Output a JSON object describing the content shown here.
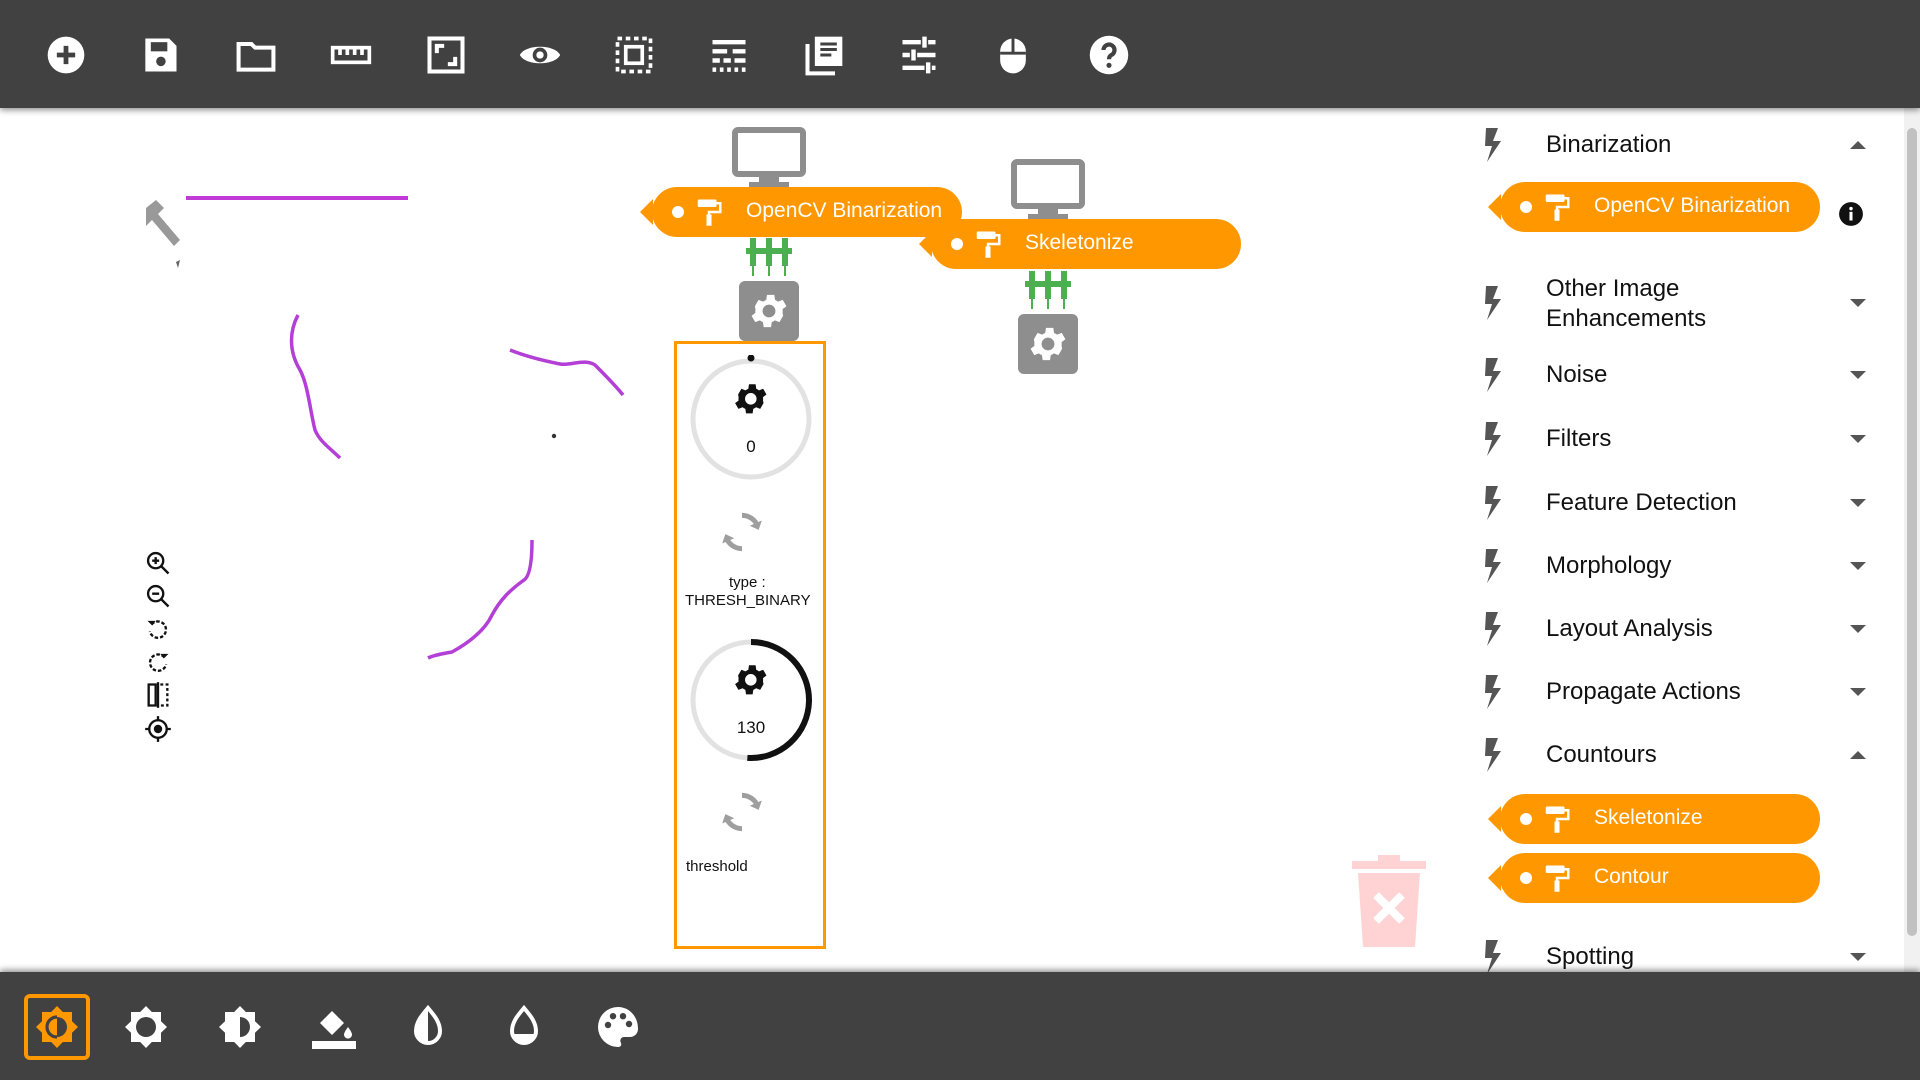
{
  "colors": {
    "toolbar": "#414141",
    "accent": "#ff9800",
    "node_gray": "#8e8e8e",
    "connector_green": "#4caf50",
    "stroke": "#b43fd6"
  },
  "top_toolbar": {
    "icons": [
      "add-icon",
      "save-icon",
      "folder-icon",
      "ruler-icon",
      "crop-frame-icon",
      "eye-icon",
      "select-all-icon",
      "line-style-icon",
      "library-icon",
      "sliders-icon",
      "mouse-icon",
      "help-icon"
    ]
  },
  "bottom_toolbar": {
    "icons": [
      "brightness-auto-icon",
      "brightness-icon",
      "contrast-half-icon",
      "paint-bucket-icon",
      "invert-icon",
      "drop-icon",
      "palette-icon"
    ],
    "active": "brightness-auto-icon"
  },
  "viewer_tools": [
    "zoom-in-icon",
    "zoom-out-icon",
    "rotate-left-icon",
    "rotate-right-icon",
    "flip-icon",
    "center-icon"
  ],
  "pipeline": {
    "nodes": [
      {
        "label": "OpenCV Binarization"
      },
      {
        "label": "Skeletonize"
      }
    ]
  },
  "params": {
    "knob1_value": "0",
    "knob1_fraction": 0,
    "type_label": "type :",
    "type_value": "THRESH_BINARY",
    "knob2_value": "130",
    "knob2_fraction": 0.51,
    "threshold_label": "threshold"
  },
  "sidebar": {
    "categories": [
      {
        "name": "Binarization",
        "expanded": true,
        "items": [
          "OpenCV Binarization"
        ]
      },
      {
        "name": "Other Image Enhancements",
        "expanded": false
      },
      {
        "name": "Noise",
        "expanded": false
      },
      {
        "name": "Filters",
        "expanded": false
      },
      {
        "name": "Feature Detection",
        "expanded": false
      },
      {
        "name": "Morphology",
        "expanded": false
      },
      {
        "name": "Layout Analysis",
        "expanded": false
      },
      {
        "name": "Propagate Actions",
        "expanded": false
      },
      {
        "name": "Countours",
        "expanded": true,
        "items": [
          "Skeletonize",
          "Contour"
        ]
      },
      {
        "name": "Spotting",
        "expanded": false
      }
    ]
  }
}
